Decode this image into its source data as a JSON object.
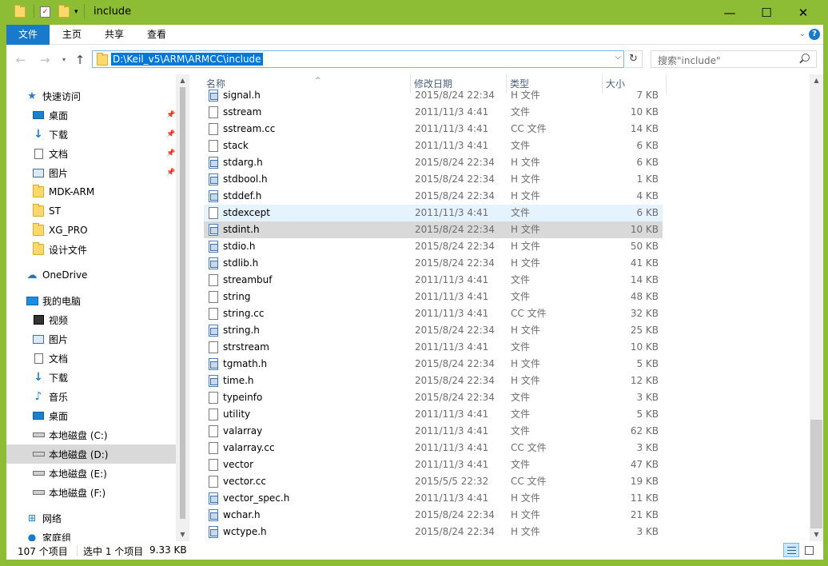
{
  "window": {
    "title": "include",
    "accent": "#8cbd35",
    "controls": {
      "minimize": "—",
      "maximize": "☐",
      "close": "✕"
    }
  },
  "ribbon": {
    "tabs": [
      "文件",
      "主页",
      "共享",
      "查看"
    ]
  },
  "address": {
    "path": "D:\\Keil_v5\\ARM\\ARMCC\\include",
    "search_placeholder": "搜索\"include\""
  },
  "nav": {
    "items": [
      {
        "label": "快速访问",
        "icon": "star-icon"
      },
      {
        "label": "桌面",
        "icon": "desktop-icon",
        "pinned": true
      },
      {
        "label": "下载",
        "icon": "download-icon",
        "pinned": true
      },
      {
        "label": "文档",
        "icon": "document-icon",
        "pinned": true
      },
      {
        "label": "图片",
        "icon": "picture-icon",
        "pinned": true
      },
      {
        "label": "MDK-ARM",
        "icon": "folder-icon"
      },
      {
        "label": "ST",
        "icon": "folder-icon"
      },
      {
        "label": "XG_PRO",
        "icon": "folder-icon"
      },
      {
        "label": "设计文件",
        "icon": "folder-icon"
      },
      {
        "label": "OneDrive",
        "icon": "cloud-icon"
      },
      {
        "label": "我的电脑",
        "icon": "computer-icon"
      },
      {
        "label": "视频",
        "icon": "video-icon"
      },
      {
        "label": "图片",
        "icon": "picture-icon"
      },
      {
        "label": "文档",
        "icon": "document-icon"
      },
      {
        "label": "下载",
        "icon": "download-icon"
      },
      {
        "label": "音乐",
        "icon": "music-icon"
      },
      {
        "label": "桌面",
        "icon": "desktop-icon"
      },
      {
        "label": "本地磁盘 (C:)",
        "icon": "drive-icon"
      },
      {
        "label": "本地磁盘 (D:)",
        "icon": "drive-icon",
        "selected": true
      },
      {
        "label": "本地磁盘 (E:)",
        "icon": "drive-icon"
      },
      {
        "label": "本地磁盘 (F:)",
        "icon": "drive-icon"
      },
      {
        "label": "网络",
        "icon": "network-icon"
      },
      {
        "label": "家庭组",
        "icon": "homegroup-icon"
      }
    ]
  },
  "columns": {
    "name": "名称",
    "modified": "修改日期",
    "type": "类型",
    "size": "大小"
  },
  "files": [
    {
      "name": "signal.h",
      "date": "2015/8/24 22:34",
      "type": "H 文件",
      "size": "7 KB",
      "kind": "h"
    },
    {
      "name": "sstream",
      "date": "2011/11/3 4:41",
      "type": "文件",
      "size": "10 KB",
      "kind": "file"
    },
    {
      "name": "sstream.cc",
      "date": "2011/11/3 4:41",
      "type": "CC 文件",
      "size": "14 KB",
      "kind": "file"
    },
    {
      "name": "stack",
      "date": "2011/11/3 4:41",
      "type": "文件",
      "size": "6 KB",
      "kind": "file"
    },
    {
      "name": "stdarg.h",
      "date": "2015/8/24 22:34",
      "type": "H 文件",
      "size": "6 KB",
      "kind": "h"
    },
    {
      "name": "stdbool.h",
      "date": "2015/8/24 22:34",
      "type": "H 文件",
      "size": "1 KB",
      "kind": "h"
    },
    {
      "name": "stddef.h",
      "date": "2015/8/24 22:34",
      "type": "H 文件",
      "size": "4 KB",
      "kind": "h"
    },
    {
      "name": "stdexcept",
      "date": "2011/11/3 4:41",
      "type": "文件",
      "size": "6 KB",
      "kind": "file",
      "state": "hover"
    },
    {
      "name": "stdint.h",
      "date": "2015/8/24 22:34",
      "type": "H 文件",
      "size": "10 KB",
      "kind": "h",
      "state": "selected"
    },
    {
      "name": "stdio.h",
      "date": "2015/8/24 22:34",
      "type": "H 文件",
      "size": "50 KB",
      "kind": "h"
    },
    {
      "name": "stdlib.h",
      "date": "2015/8/24 22:34",
      "type": "H 文件",
      "size": "41 KB",
      "kind": "h"
    },
    {
      "name": "streambuf",
      "date": "2011/11/3 4:41",
      "type": "文件",
      "size": "14 KB",
      "kind": "file"
    },
    {
      "name": "string",
      "date": "2011/11/3 4:41",
      "type": "文件",
      "size": "48 KB",
      "kind": "file"
    },
    {
      "name": "string.cc",
      "date": "2011/11/3 4:41",
      "type": "CC 文件",
      "size": "32 KB",
      "kind": "file"
    },
    {
      "name": "string.h",
      "date": "2015/8/24 22:34",
      "type": "H 文件",
      "size": "25 KB",
      "kind": "h"
    },
    {
      "name": "strstream",
      "date": "2011/11/3 4:41",
      "type": "文件",
      "size": "10 KB",
      "kind": "file"
    },
    {
      "name": "tgmath.h",
      "date": "2015/8/24 22:34",
      "type": "H 文件",
      "size": "5 KB",
      "kind": "h"
    },
    {
      "name": "time.h",
      "date": "2015/8/24 22:34",
      "type": "H 文件",
      "size": "12 KB",
      "kind": "h"
    },
    {
      "name": "typeinfo",
      "date": "2015/8/24 22:34",
      "type": "文件",
      "size": "3 KB",
      "kind": "file"
    },
    {
      "name": "utility",
      "date": "2011/11/3 4:41",
      "type": "文件",
      "size": "5 KB",
      "kind": "file"
    },
    {
      "name": "valarray",
      "date": "2011/11/3 4:41",
      "type": "文件",
      "size": "62 KB",
      "kind": "file"
    },
    {
      "name": "valarray.cc",
      "date": "2011/11/3 4:41",
      "type": "CC 文件",
      "size": "3 KB",
      "kind": "file"
    },
    {
      "name": "vector",
      "date": "2011/11/3 4:41",
      "type": "文件",
      "size": "47 KB",
      "kind": "file"
    },
    {
      "name": "vector.cc",
      "date": "2015/5/5 22:32",
      "type": "CC 文件",
      "size": "19 KB",
      "kind": "file"
    },
    {
      "name": "vector_spec.h",
      "date": "2011/11/3 4:41",
      "type": "H 文件",
      "size": "11 KB",
      "kind": "h"
    },
    {
      "name": "wchar.h",
      "date": "2015/8/24 22:34",
      "type": "H 文件",
      "size": "21 KB",
      "kind": "h"
    },
    {
      "name": "wctype.h",
      "date": "2015/8/24 22:34",
      "type": "H 文件",
      "size": "3 KB",
      "kind": "h"
    }
  ],
  "status": {
    "count": "107 个项目",
    "selection": "选中 1 个项目",
    "selection_size": "9.33 KB"
  }
}
